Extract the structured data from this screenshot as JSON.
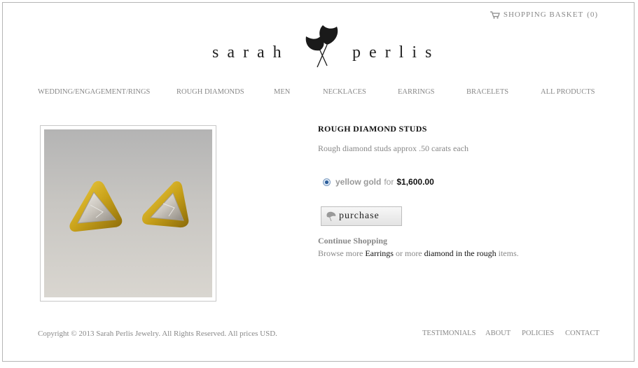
{
  "header": {
    "basket_label": "SHOPPING BASKET",
    "basket_count": "(0)",
    "logo_left": "sarah",
    "logo_right": "perlis"
  },
  "nav": {
    "items": [
      "WEDDING/ENGAGEMENT/RINGS",
      "ROUGH DIAMONDS",
      "MEN",
      "NECKLACES",
      "EARRINGS",
      "BRACELETS",
      "ALL PRODUCTS"
    ]
  },
  "product": {
    "title": "ROUGH DIAMOND STUDS",
    "description": "Rough diamond studs approx .50 carats each",
    "option_name": "yellow gold",
    "option_for": "for",
    "option_price": "$1,600.00",
    "purchase_label": "purchase",
    "continue_label": "Continue Shopping",
    "browse_prefix": "Browse more",
    "browse_category": "Earrings",
    "browse_middle": "or more",
    "browse_collection": "diamond in the rough",
    "browse_suffix": "items."
  },
  "footer": {
    "copyright": "Copyright © 2013 Sarah Perlis Jewelry. All Rights Reserved. All prices USD.",
    "links": [
      "TESTIMONIALS",
      "ABOUT",
      "POLICIES",
      "CONTACT"
    ]
  }
}
